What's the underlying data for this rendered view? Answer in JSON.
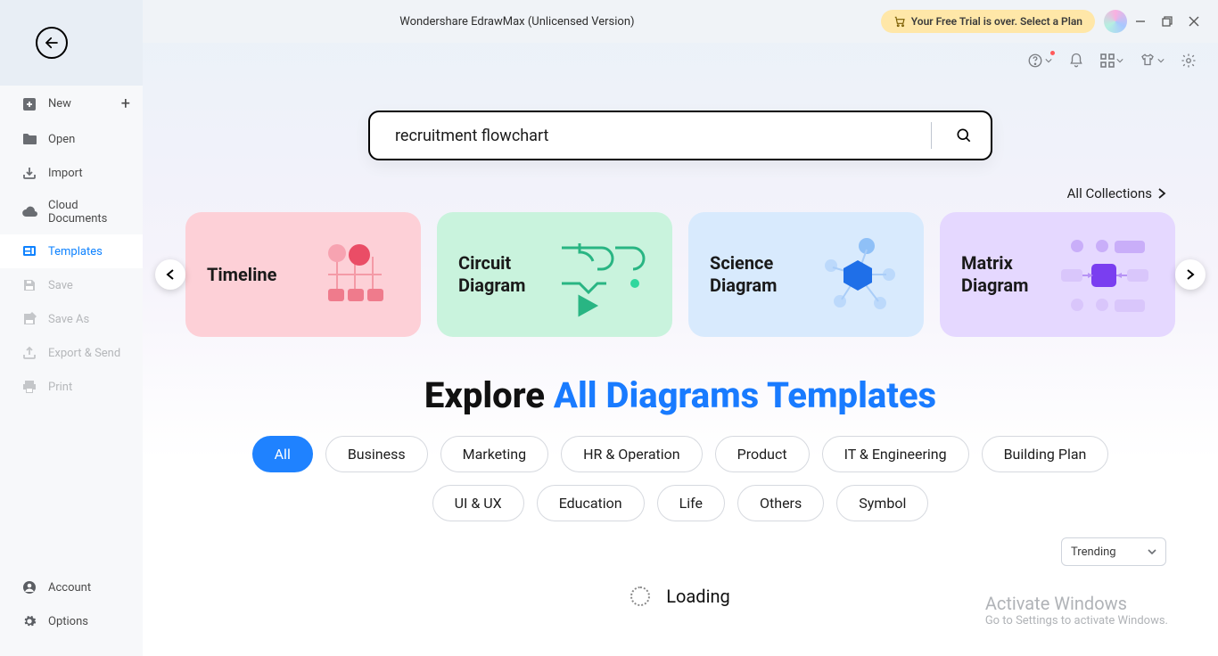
{
  "titlebar": {
    "title": "Wondershare EdrawMax (Unlicensed Version)",
    "trial_text": "Your Free Trial is over. Select a Plan"
  },
  "sidebar": {
    "items": [
      {
        "label": "New",
        "icon": "plus-square-icon",
        "plus": true,
        "disabled": false
      },
      {
        "label": "Open",
        "icon": "folder-icon",
        "disabled": false
      },
      {
        "label": "Import",
        "icon": "import-icon",
        "disabled": false
      },
      {
        "label": "Cloud Documents",
        "icon": "cloud-icon",
        "disabled": false
      },
      {
        "label": "Templates",
        "icon": "templates-icon",
        "active": true,
        "disabled": false
      },
      {
        "label": "Save",
        "icon": "save-icon",
        "disabled": true
      },
      {
        "label": "Save As",
        "icon": "save-as-icon",
        "disabled": true
      },
      {
        "label": "Export & Send",
        "icon": "export-icon",
        "disabled": true
      },
      {
        "label": "Print",
        "icon": "print-icon",
        "disabled": true
      }
    ],
    "footer": [
      {
        "label": "Account",
        "icon": "account-icon"
      },
      {
        "label": "Options",
        "icon": "gear-icon"
      }
    ]
  },
  "search": {
    "value": "recruitment flowchart"
  },
  "collections_link": "All Collections",
  "cards": [
    {
      "title": "Timeline",
      "color": "pink"
    },
    {
      "title": "Circuit Diagram",
      "color": "teal"
    },
    {
      "title": "Science Diagram",
      "color": "blue"
    },
    {
      "title": "Matrix Diagram",
      "color": "purple"
    }
  ],
  "heading": {
    "pre": "Explore ",
    "accent": "All Diagrams Templates"
  },
  "filters": [
    "All",
    "Business",
    "Marketing",
    "HR & Operation",
    "Product",
    "IT & Engineering",
    "Building Plan",
    "UI & UX",
    "Education",
    "Life",
    "Others",
    "Symbol"
  ],
  "filter_active": 0,
  "sort": {
    "value": "Trending"
  },
  "loading_text": "Loading",
  "watermark": {
    "line1": "Activate Windows",
    "line2": "Go to Settings to activate Windows."
  }
}
